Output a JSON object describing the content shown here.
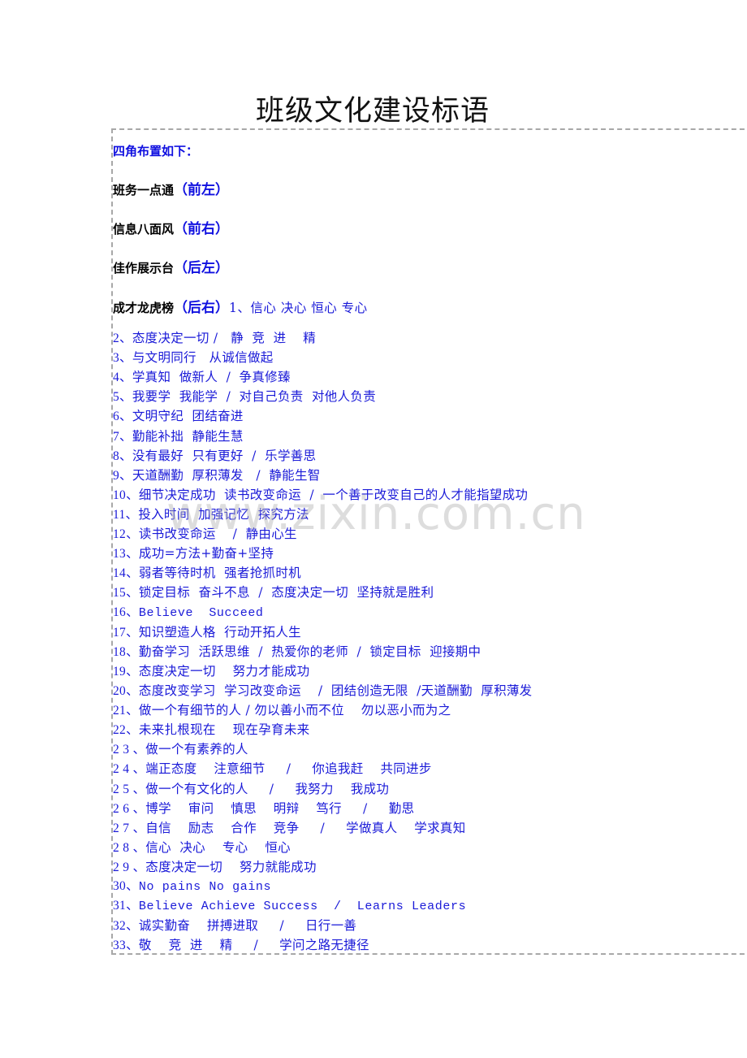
{
  "document": {
    "title": "班级文化建设标语",
    "watermark": "www.zixin.com.cn"
  },
  "layout_intro": {
    "heading": "四角布置如下：",
    "corners": [
      {
        "name": "班务一点通",
        "position": "（前左）"
      },
      {
        "name": "信息八面风",
        "position": "（前右）"
      },
      {
        "name": "佳作展示台",
        "position": "（后左）"
      },
      {
        "name": "成才龙虎榜",
        "position": "（后右）"
      }
    ]
  },
  "slogans": [
    {
      "number": "1、",
      "text": "信心  决心  恒心  专心"
    },
    {
      "number": "2、",
      "text": "态度决定一切 /   静  竞  进    精"
    },
    {
      "number": "3、",
      "text": "与文明同行   从诚信做起"
    },
    {
      "number": "4、",
      "text": "学真知  做新人  /  争真修臻"
    },
    {
      "number": "5、",
      "text": "我要学  我能学  /  对自己负责  对他人负责"
    },
    {
      "number": "6、",
      "text": "文明守纪  团结奋进"
    },
    {
      "number": "7、",
      "text": "勤能补拙  静能生慧"
    },
    {
      "number": "8、",
      "text": "没有最好  只有更好  /  乐学善思"
    },
    {
      "number": "9、",
      "text": "天道酬勤  厚积薄发   /  静能生智"
    },
    {
      "number": "10、",
      "text": "细节决定成功  读书改变命运  /  一个善于改变自己的人才能指望成功"
    },
    {
      "number": "11、",
      "text": "投入时间  加强记忆  探究方法"
    },
    {
      "number": "12、",
      "text": "读书改变命运    /  静由心生"
    },
    {
      "number": "13、",
      "text": "成功=方法+勤奋+坚持"
    },
    {
      "number": "14、",
      "text": "弱者等待时机  强者抢抓时机"
    },
    {
      "number": "15、",
      "text": "锁定目标  奋斗不息  /  态度决定一切  坚持就是胜利"
    },
    {
      "number": "16、",
      "text": "Believe  Succeed",
      "latin": true
    },
    {
      "number": "17、",
      "text": "知识塑造人格  行动开拓人生"
    },
    {
      "number": "18、",
      "text": "勤奋学习  活跃思维  /  热爱你的老师  /  锁定目标  迎接期中"
    },
    {
      "number": "19、",
      "text": "态度决定一切    努力才能成功"
    },
    {
      "number": "20、",
      "text": "态度改变学习  学习改变命运    /  团结创造无限  /天道酬勤  厚积薄发"
    },
    {
      "number": "21、",
      "text": "做一个有细节的人 / 勿以善小而不位    勿以恶小而为之"
    },
    {
      "number": "22、",
      "text": "未来扎根现在    现在孕育未来"
    },
    {
      "number": "2 3 、",
      "text": "做一个有素养的人"
    },
    {
      "number": "2 4 、",
      "text": "端正态度    注意细节     /     你追我赶    共同进步"
    },
    {
      "number": "2 5 、",
      "text": "做一个有文化的人     /     我努力    我成功"
    },
    {
      "number": "2 6 、",
      "text": "博学    审问    慎思    明辩    笃行     /     勤思"
    },
    {
      "number": "2 7 、",
      "text": "自信    励志    合作    竞争     /     学做真人    学求真知"
    },
    {
      "number": "2 8 、",
      "text": "信心  决心    专心    恒心"
    },
    {
      "number": "2 9 、",
      "text": "态度决定一切    努力就能成功"
    },
    {
      "number": "30、",
      "text": "No pains No gains",
      "latin": true
    },
    {
      "number": "31、",
      "text": "Believe Achieve Success  /  Learns Leaders",
      "latin": true
    },
    {
      "number": "32、",
      "text": "诚实勤奋    拼搏进取     /     日行一善"
    },
    {
      "number": "33、",
      "text": "敬    竞  进    精     /     学问之路无捷径"
    }
  ]
}
